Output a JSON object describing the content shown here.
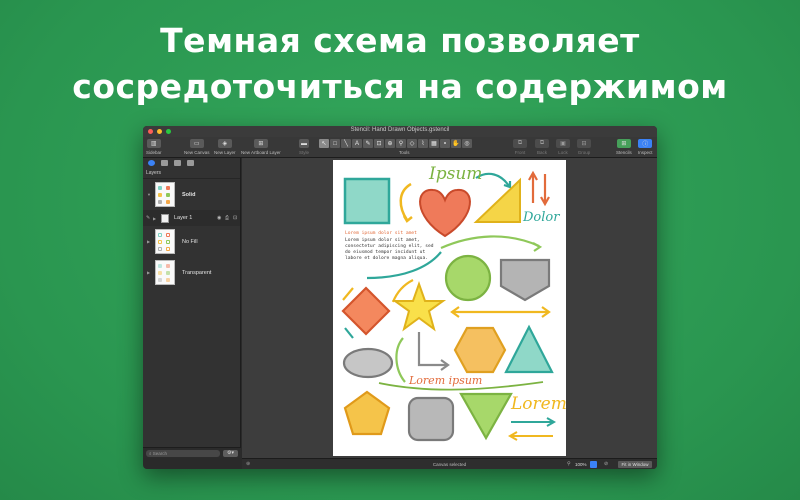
{
  "headline": {
    "line1": "Темная схема позволяет",
    "line2": "сосредоточиться на содержимом"
  },
  "window": {
    "title": "Stencil: Hand Drawn Objects.gstencil"
  },
  "toolbar": {
    "sidebar_label": "Sidebar",
    "new_canvas_label": "New Canvas",
    "new_layer_label": "New Layer",
    "new_artboard_layer_label": "New Artboard Layer",
    "style_label": "Style",
    "tools_label": "Tools",
    "front_label": "Front",
    "back_label": "Back",
    "lock_label": "Lock",
    "group_label": "Group",
    "stencils_label": "Stencils",
    "inspect_label": "Inspect"
  },
  "sidebar": {
    "header": "Layers",
    "layers": [
      {
        "name": "Solid"
      },
      {
        "name": "Layer 1"
      },
      {
        "name": "No Fill"
      },
      {
        "name": "Transparent"
      }
    ],
    "search_placeholder": "Search"
  },
  "page": {
    "ipsum": "Ipsum",
    "dolor": "Dolor",
    "lorem_ipsum": "Lorem ipsum",
    "lorem": "Lorem",
    "text_heading": "Lorem ipsum dolor sit amet",
    "text_body": [
      "Lorem ipsum dolor sit amet,",
      "consectetur adipiscing elit, sed",
      "do eiusmod tempor incidunt ut",
      "labore et dolore magna aliqua."
    ]
  },
  "status": {
    "text": "Canvas selected",
    "zoom": "100%",
    "fit_label": "Fit in Window"
  },
  "colors": {
    "background": "#2ea056",
    "accent": "#3b82f6"
  }
}
